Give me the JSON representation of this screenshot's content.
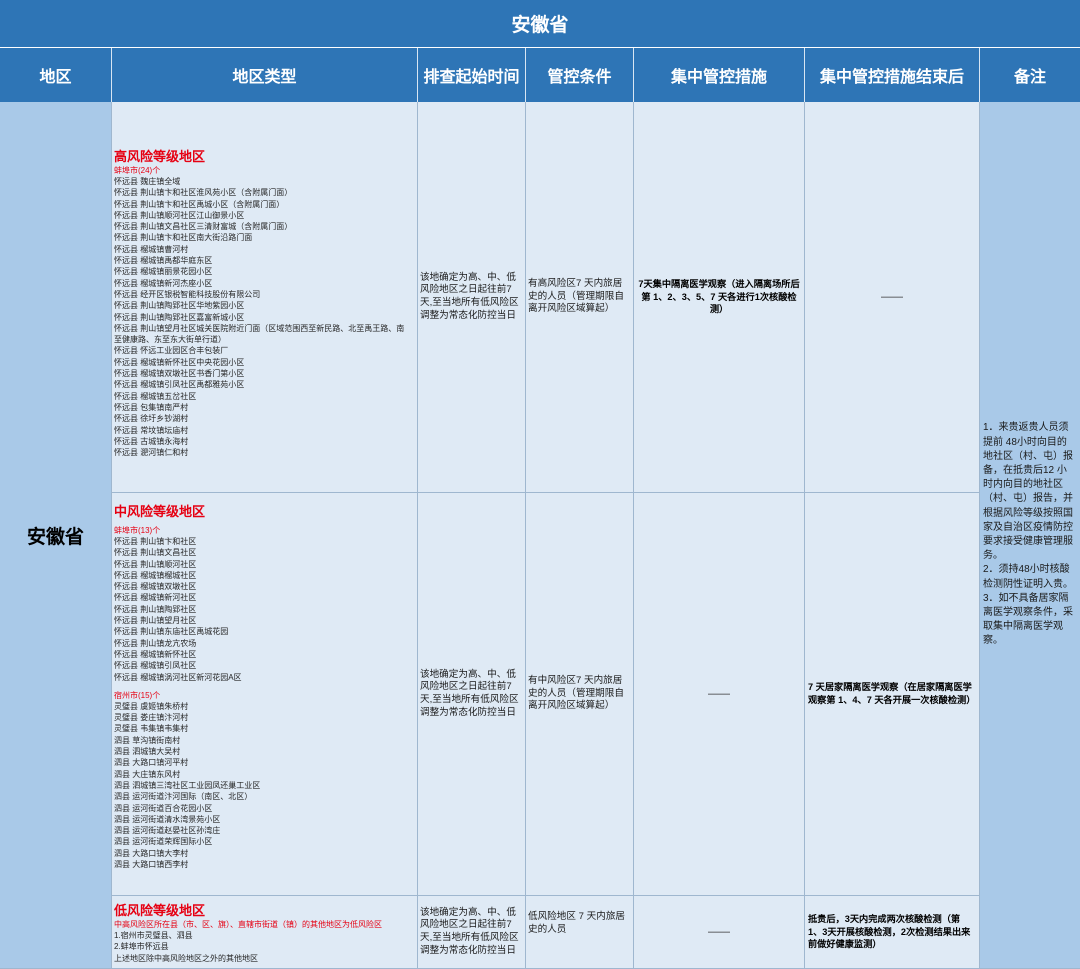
{
  "title": "安徽省",
  "headers": [
    "地区",
    "地区类型",
    "排查起始时间",
    "管控条件",
    "集中管控措施",
    "集中管控措施结束后",
    "备注"
  ],
  "region": "安徽省",
  "high": {
    "level": "高风险等级地区",
    "city": "蚌埠市(24)个",
    "items": [
      "怀远县 魏庄镇全域",
      "怀远县 荆山镇卞和社区淮风苑小区（含附属门面）",
      "怀远县 荆山镇卞和社区禹城小区（含附属门面）",
      "怀远县 荆山镇顺河社区江山御景小区",
      "怀远县 荆山镇文昌社区三清财富城（含附属门面）",
      "怀远县 荆山镇卞和社区南大街沿路门面",
      "怀远县 榴城镇曹河村",
      "怀远县 榴城镇禹都华庭东区",
      "怀远县 榴城镇丽景花园小区",
      "怀远县 榴城镇新河杰座小区",
      "怀远县 经开区银税智能科技股份有限公司",
      "怀远县 荆山镇陶郢社区华地紫园小区",
      "怀远县 荆山镇陶郢社区嘉富新城小区",
      "怀远县 荆山镇望月社区城关医院附近门面（区域范围西至新民路、北至禹王路、南至健康路、东至东大街单行道）",
      "怀远县 怀远工业园区合丰包装厂",
      "怀远县 榴城镇新怀社区中央花园小区",
      "怀远县 榴城镇双墩社区书香门第小区",
      "怀远县 榴城镇引凤社区禹都雅苑小区",
      "怀远县 榴城镇五岔社区",
      "怀远县 包集镇南严村",
      "怀远县 徐圩乡钞湖村",
      "怀远县 常坟镇坛庙村",
      "怀远县 古城镇永海村",
      "怀远县 淝河镇仁和村"
    ],
    "start_time": "该地确定为高、中、低风险地区之日起往前7天,至当地所有低风险区调整为常态化防控当日",
    "condition": "有高风险区7 天内旅居史的人员（管理期限自离开风险区域算起）",
    "measure": "7天集中隔离医学观察（进入隔离场所后第 1、2、3、5、7 天各进行1次核酸检测）",
    "after": "——"
  },
  "mid": {
    "level": "中风险等级地区",
    "city1": "蚌埠市(13)个",
    "items1": [
      "怀远县 荆山镇卞和社区",
      "怀远县 荆山镇文昌社区",
      "怀远县 荆山镇顺河社区",
      "怀远县 榴城镇榴城社区",
      "怀远县 榴城镇双墩社区",
      "怀远县 榴城镇新河社区",
      "怀远县 荆山镇陶郢社区",
      "怀远县 荆山镇望月社区",
      "怀远县 荆山镇东庙社区禹城花园",
      "怀远县 荆山镇龙亢农场",
      "怀远县 榴城镇新怀社区",
      "怀远县 榴城镇引凤社区",
      "怀远县 榴城镇涡河社区新河花园A区"
    ],
    "city2": "宿州市(15)个",
    "items2": [
      "灵璧县 虞姬镇朱桥村",
      "灵璧县 娄庄镇汴河村",
      "灵璧县 韦集镇韦集村",
      "泗县 草沟镇街南村",
      "泗县 泗城镇大吴村",
      "泗县 大路口镇河平村",
      "泗县 大庄镇东风村",
      "泗县 泗城镇三湾社区工业园凤还巢工业区",
      "泗县 运河街道汴河国际（南区、北区）",
      "泗县 运河街道百合花园小区",
      "泗县 运河街道清水湾景苑小区",
      "泗县 运河街道赵晏社区孙湾庄",
      "泗县 运河街道荣辉国际小区",
      "泗县 大路口镇大李村",
      "泗县 大路口镇西李村"
    ],
    "start_time": "该地确定为高、中、低风险地区之日起往前7天,至当地所有低风险区调整为常态化防控当日",
    "condition": "有中风险区7 天内旅居史的人员（管理期限自离开风险区域算起）",
    "measure": "——",
    "after": "7 天居家隔离医学观察（在居家隔离医学观察第 1、4、7 天各开展一次核酸检测）"
  },
  "low": {
    "level": "低风险等级地区",
    "desc": "中高风险区所在县（市、区、旗）、直辖市街道（镇）的其他地区为低风险区",
    "items": [
      "1.宿州市灵璧县、泗县",
      "2.蚌埠市怀远县",
      "上述地区除中高风险地区之外的其他地区"
    ],
    "start_time": "该地确定为高、中、低风险地区之日起往前7天,至当地所有低风险区调整为常态化防控当日",
    "condition": "低风险地区 7 天内旅居史的人员",
    "measure": "——",
    "after": "抵贵后，3天内完成两次核酸检测（第 1、3天开展核酸检测，2次检测结果出来前做好健康监测）"
  },
  "notes": [
    "1．来贵返贵人员须提前 48小时向目的地社区（村、屯）报备，在抵贵后12 小时内向目的地社区（村、屯）报告，并根据风险等级按照国家及自治区疫情防控要求接受健康管理服务。",
    "2．须持48小时核酸检测阴性证明入贵。",
    "3．如不具备居家隔离医学观察条件，采取集中隔离医学观察。"
  ]
}
